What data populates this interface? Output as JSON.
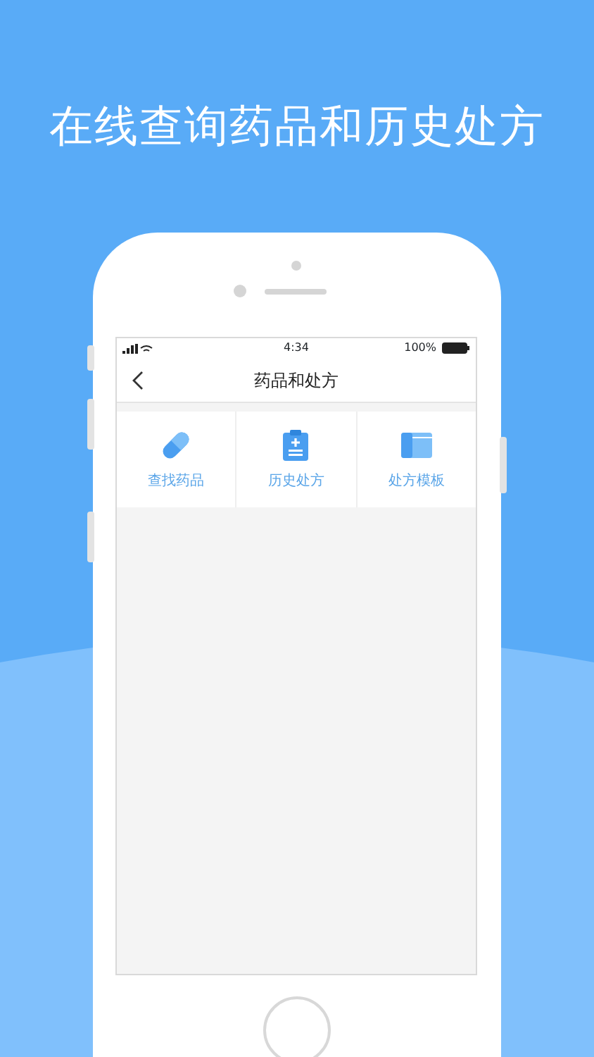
{
  "headline": "在线查询药品和历史处方",
  "status_bar": {
    "time": "4:34",
    "battery": "100%"
  },
  "nav": {
    "title": "药品和处方"
  },
  "tiles": [
    {
      "label": "查找药品",
      "kind": "pill"
    },
    {
      "label": "历史处方",
      "kind": "clipboard"
    },
    {
      "label": "处方模板",
      "kind": "template"
    }
  ]
}
